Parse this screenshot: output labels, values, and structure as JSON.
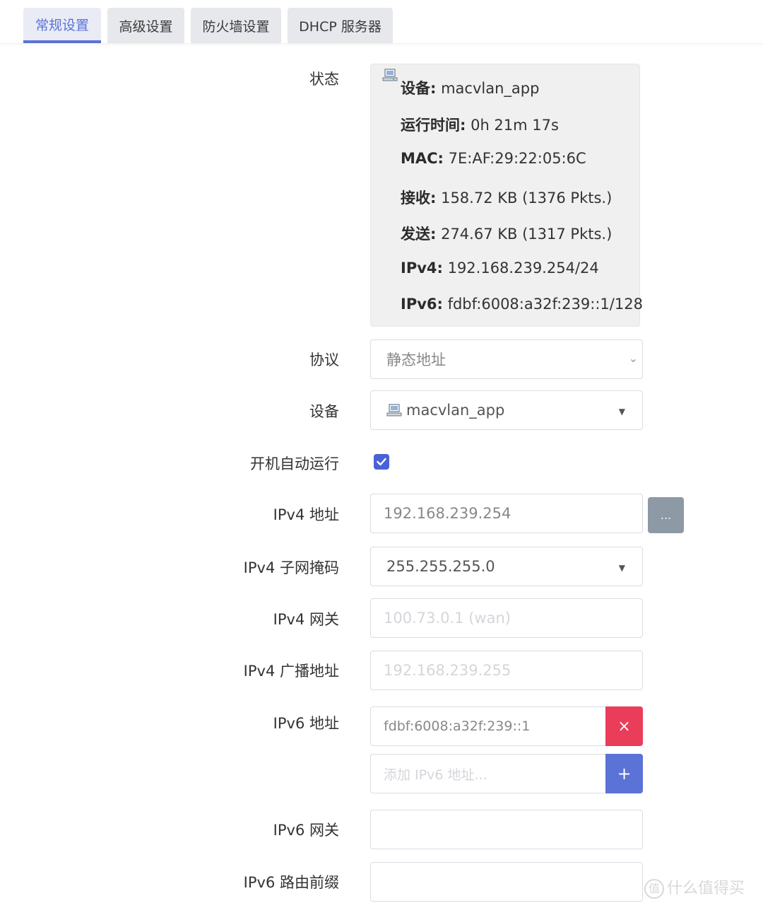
{
  "tabs": [
    {
      "label": "常规设置",
      "active": true
    },
    {
      "label": "高级设置",
      "active": false
    },
    {
      "label": "防火墙设置",
      "active": false
    },
    {
      "label": "DHCP 服务器",
      "active": false
    }
  ],
  "status": {
    "label": "状态",
    "icon": "network-device-icon",
    "lines": [
      {
        "key": "设备:",
        "value": " macvlan_app"
      },
      {
        "key": "运行时间:",
        "value": " 0h 21m 17s"
      },
      {
        "key": "MAC:",
        "value": " 7E:AF:29:22:05:6C"
      },
      {
        "key": "接收:",
        "value": " 158.72 KB (1376 Pkts.)"
      },
      {
        "key": "发送:",
        "value": " 274.67 KB (1317 Pkts.)"
      },
      {
        "key": "IPv4:",
        "value": " 192.168.239.254/24"
      },
      {
        "key": "IPv6:",
        "value": " fdbf:6008:a32f:239::1/128"
      }
    ]
  },
  "protocol": {
    "label": "协议",
    "value": "静态地址"
  },
  "device": {
    "label": "设备",
    "value": "macvlan_app"
  },
  "autostart": {
    "label": "开机自动运行",
    "checked": true
  },
  "ipv4_addr": {
    "label": "IPv4 地址",
    "value": "192.168.239.254",
    "more_label": "..."
  },
  "ipv4_mask": {
    "label": "IPv4 子网掩码",
    "value": "255.255.255.0"
  },
  "ipv4_gw": {
    "label": "IPv4 网关",
    "placeholder": "100.73.0.1 (wan)"
  },
  "ipv4_bcast": {
    "label": "IPv4 广播地址",
    "placeholder": "192.168.239.255"
  },
  "ipv6_addr": {
    "label": "IPv6 地址",
    "value": "fdbf:6008:a32f:239::1",
    "add_placeholder": "添加 IPv6 地址...",
    "delete_label": "×",
    "add_label": "+"
  },
  "ipv6_gw": {
    "label": "IPv6 网关",
    "value": ""
  },
  "ipv6_prefix": {
    "label": "IPv6 路由前缀",
    "value": ""
  },
  "watermark": {
    "logo": "值",
    "text": "什么值得买"
  },
  "colors": {
    "accent": "#5b72d6",
    "danger": "#ea3d5a",
    "muted_button": "#8e99a6"
  }
}
